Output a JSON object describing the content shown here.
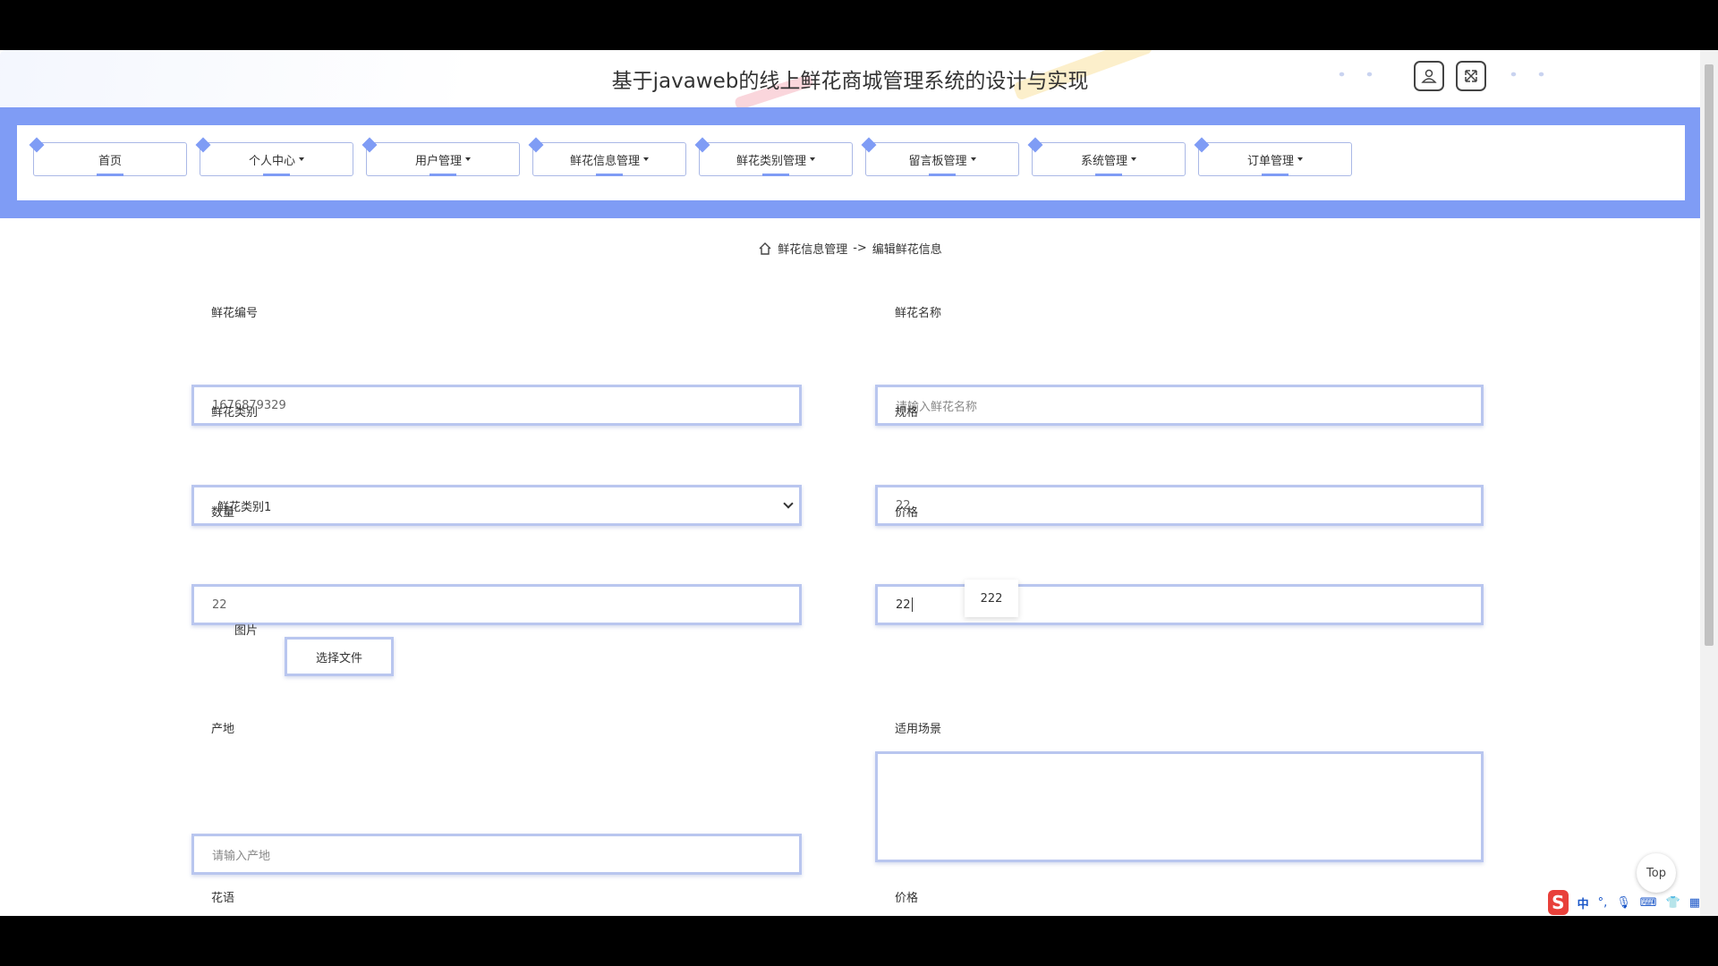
{
  "header": {
    "title": "基于javaweb的线上鲜花商城管理系统的设计与实现",
    "user_icon": "user-icon",
    "fullscreen_icon": "fullscreen-icon"
  },
  "nav": {
    "items": [
      {
        "label": "首页",
        "dropdown": false
      },
      {
        "label": "个人中心",
        "dropdown": true
      },
      {
        "label": "用户管理",
        "dropdown": true
      },
      {
        "label": "鲜花信息管理",
        "dropdown": true
      },
      {
        "label": "鲜花类别管理",
        "dropdown": true
      },
      {
        "label": "留言板管理",
        "dropdown": true
      },
      {
        "label": "系统管理",
        "dropdown": true
      },
      {
        "label": "订单管理",
        "dropdown": true
      }
    ]
  },
  "breadcrumb": {
    "icon": "home-icon",
    "parent": "鲜花信息管理",
    "separator": "->",
    "current": "编辑鲜花信息"
  },
  "form": {
    "flower_no_label": "鲜花编号",
    "flower_no_value": "1676879329",
    "flower_name_label": "鲜花名称",
    "flower_name_placeholder": "请输入鲜花名称",
    "category_label": "鲜花类别",
    "category_value": "鲜花类别1",
    "spec_label": "规格",
    "spec_value": "22",
    "quantity_label": "数量",
    "quantity_value": "22",
    "price_label": "价格",
    "price_value": "22",
    "price_suggestion": "222",
    "image_label": "图片",
    "file_button_label": "选择文件",
    "origin_label": "产地",
    "origin_placeholder": "请输入产地",
    "scene_label": "适用场景",
    "flower_language_label": "花语",
    "price2_label": "价格"
  },
  "top_button": "Top",
  "ime": {
    "lang": "中"
  },
  "colors": {
    "accent": "#7f9cf5",
    "input_border": "#b9c6ef"
  }
}
